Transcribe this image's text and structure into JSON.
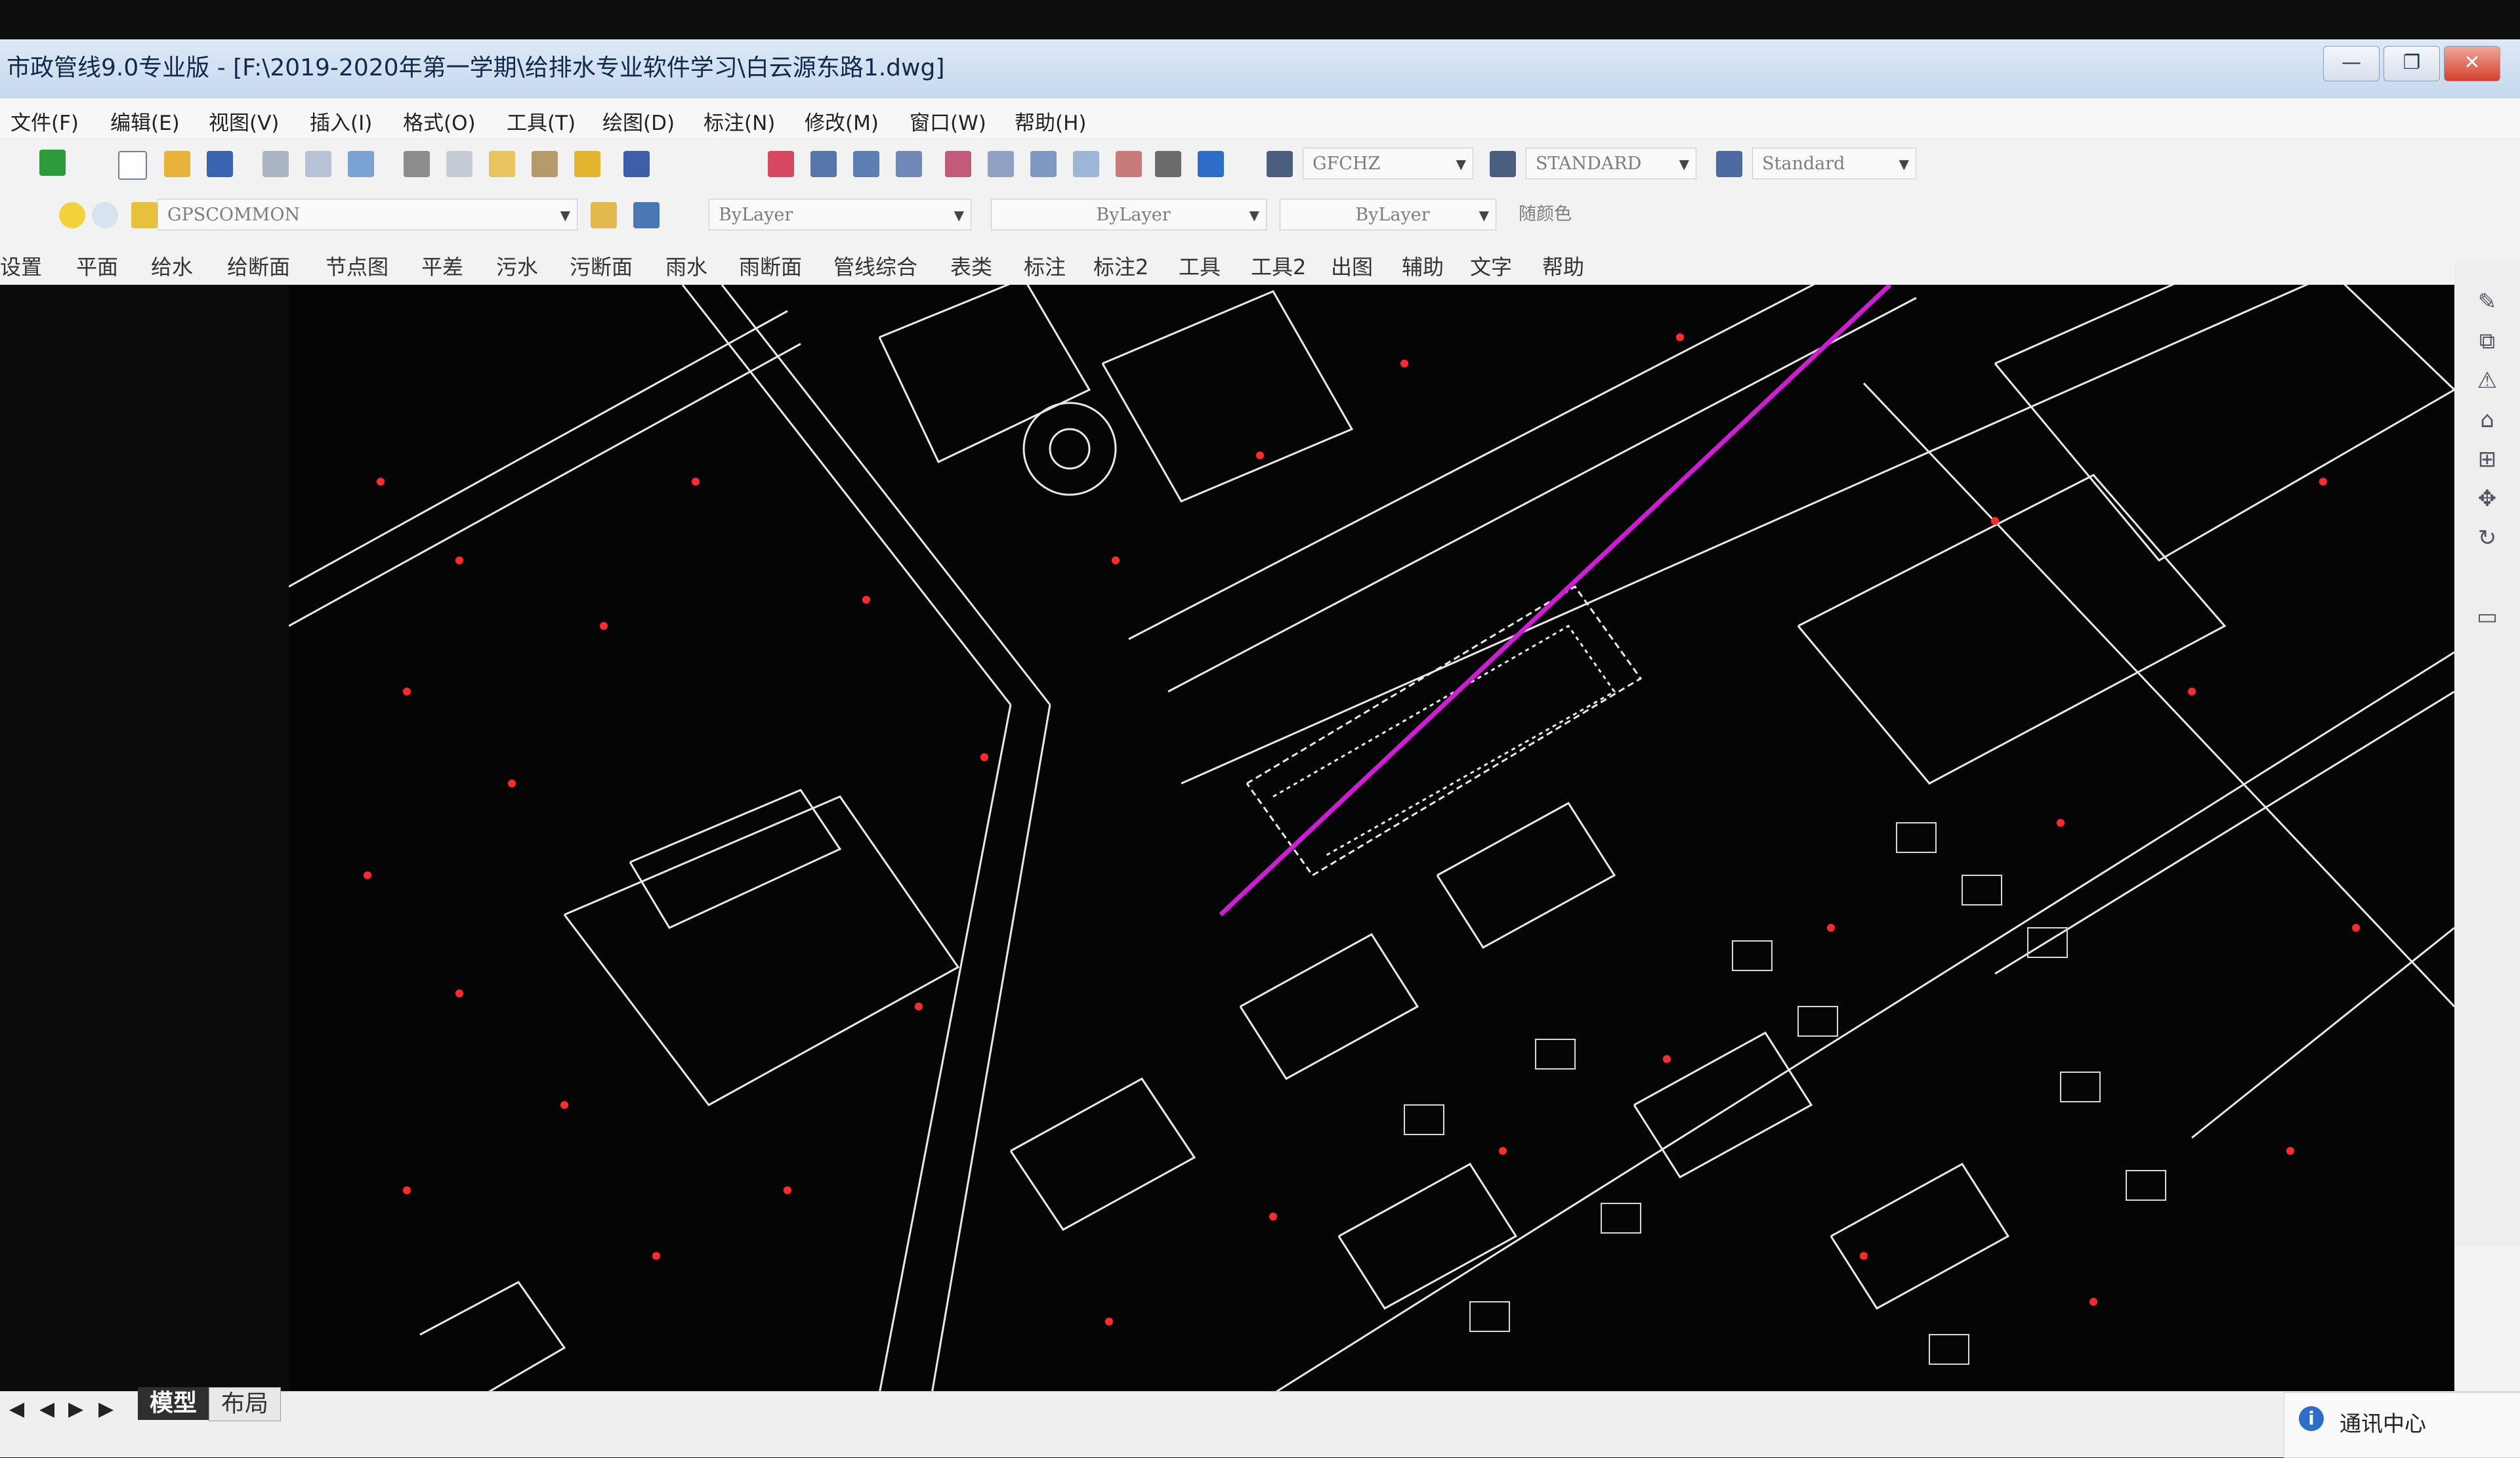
{
  "window": {
    "title": "市政管线9.0专业版 - [F:\\2019-2020年第一学期\\给排水专业软件学习\\白云源东路1.dwg]",
    "controls": [
      "—",
      "❐",
      "✕"
    ]
  },
  "menu": [
    "文件(F)",
    "编辑(E)",
    "视图(V)",
    "插入(I)",
    "格式(O)",
    "工具(T)",
    "绘图(D)",
    "标注(N)",
    "修改(M)",
    "窗口(W)",
    "帮助(H)"
  ],
  "toolbar": {
    "text_style": "GFCHZ",
    "dim_style": "STANDARD",
    "table_style": "Standard",
    "layer": "GPSCOMMON",
    "color": "ByLayer",
    "linetype": "ByLayer",
    "lineweight": "ByLayer",
    "plotstyle": "随颜色"
  },
  "ribbon": [
    "设置",
    "平面",
    "给水",
    "给断面",
    "节点图",
    "平差",
    "污水",
    "污断面",
    "雨水",
    "雨断面",
    "管线综合",
    "表类",
    "标注",
    "标注2",
    "工具",
    "工具2",
    "出图",
    "辅助",
    "文字",
    "帮助"
  ],
  "tabs": {
    "model": "模型",
    "layout": "布局"
  },
  "notification": {
    "title": "通讯中心"
  },
  "colors": {
    "canvas_bg": "#050505",
    "linework": "#e8e8e8",
    "points": "#ff2a2a",
    "pipeline": "#d21bd8"
  }
}
